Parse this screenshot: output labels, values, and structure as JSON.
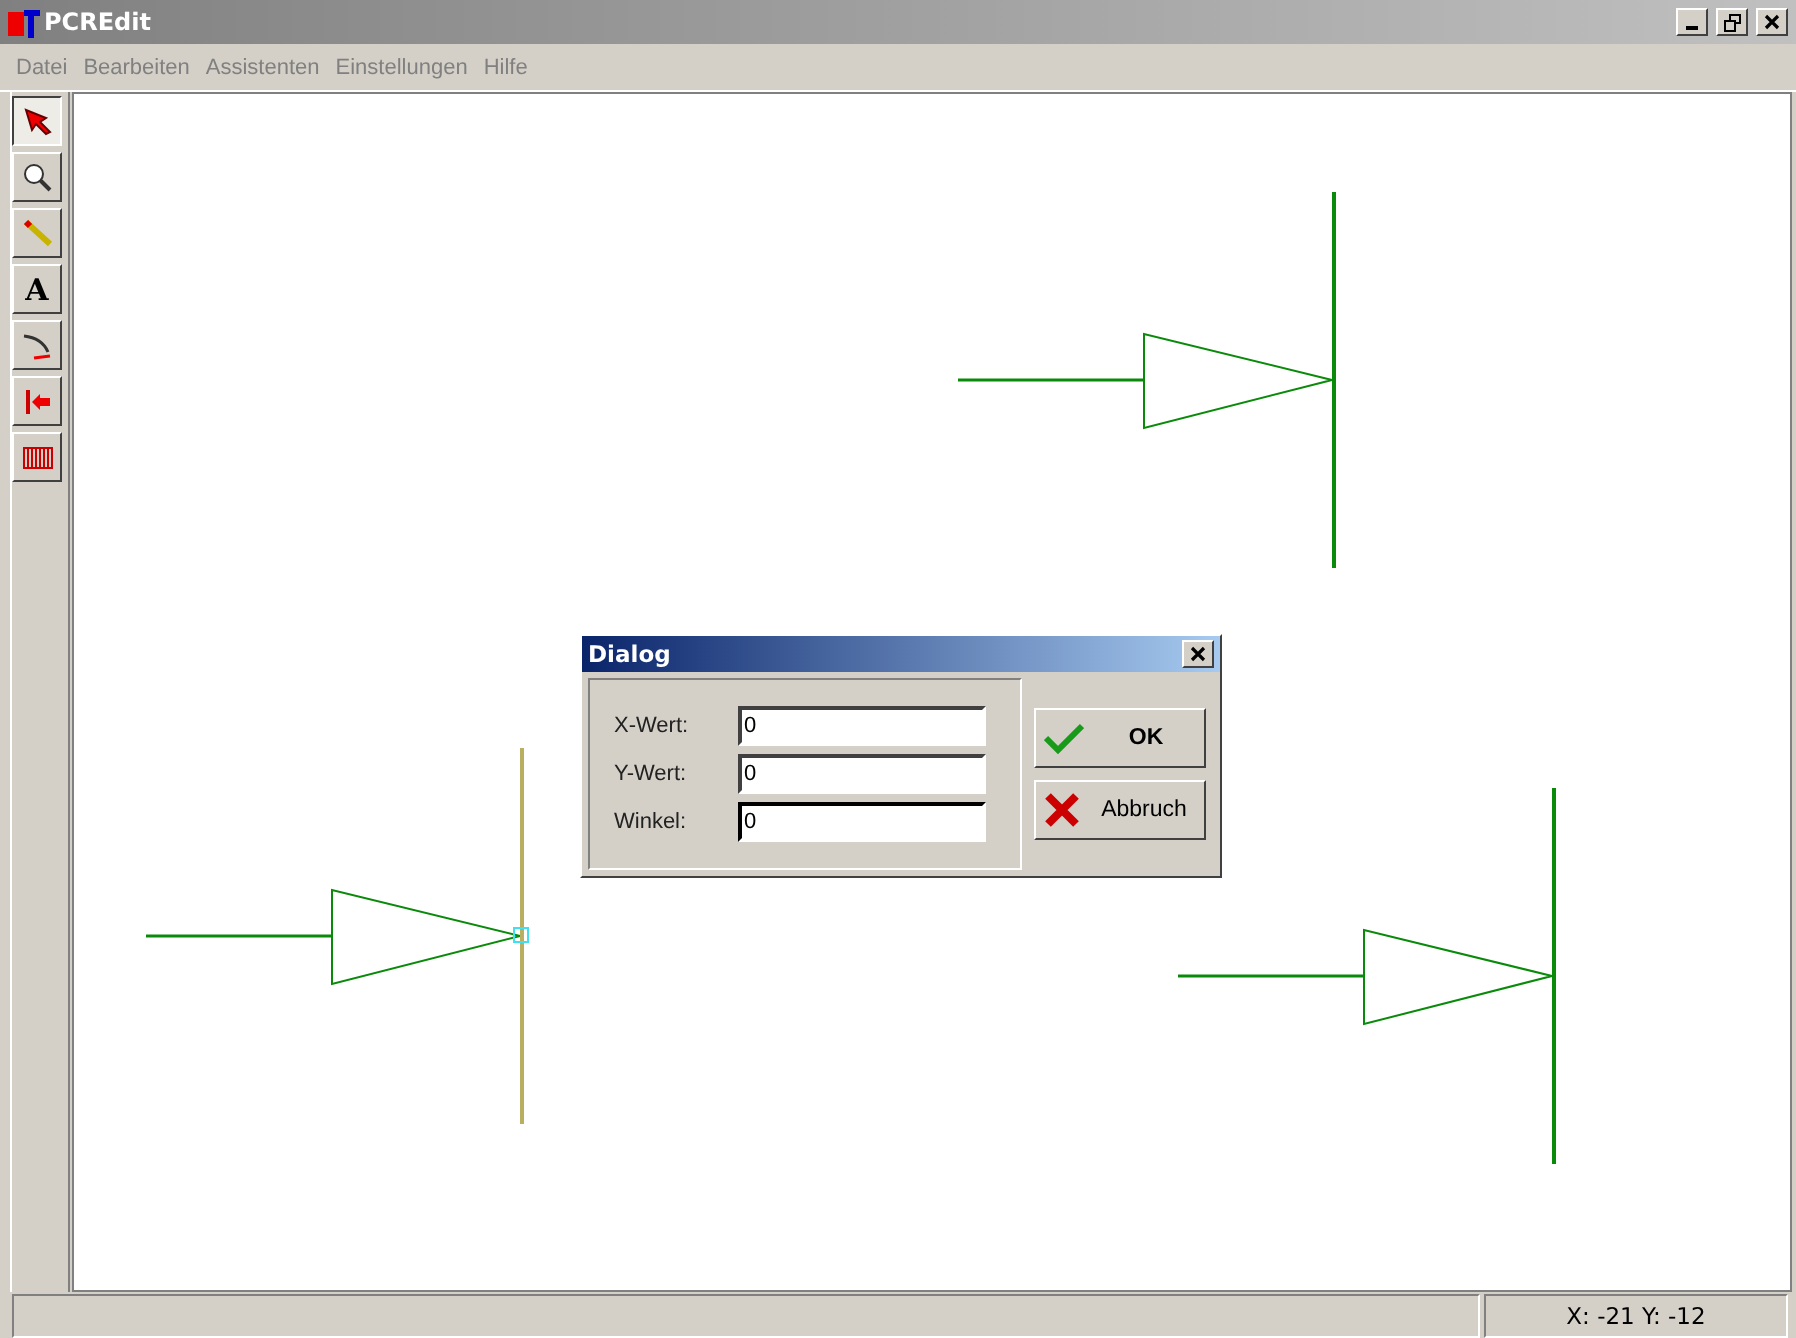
{
  "window": {
    "title": "PCREdit"
  },
  "menu": [
    "Datei",
    "Bearbeiten",
    "Assistenten",
    "Einstellungen",
    "Hilfe"
  ],
  "tools": [
    {
      "kind": "pointer",
      "selected": true
    },
    {
      "kind": "zoom",
      "selected": false
    },
    {
      "kind": "pencil",
      "selected": false
    },
    {
      "kind": "text",
      "label": "A",
      "selected": false
    },
    {
      "kind": "curve",
      "selected": false
    },
    {
      "kind": "pin",
      "selected": false
    },
    {
      "kind": "grid",
      "selected": false
    }
  ],
  "symbols": [
    {
      "selected": false
    },
    {
      "selected": true
    },
    {
      "selected": false
    }
  ],
  "dialog": {
    "title": "Dialog",
    "fields": [
      {
        "label": "X-Wert:",
        "value": "0",
        "focused": false
      },
      {
        "label": "Y-Wert:",
        "value": "0",
        "focused": false
      },
      {
        "label": "Winkel:",
        "value": "0",
        "focused": true
      }
    ],
    "buttons": [
      {
        "kind": "ok",
        "label": "OK"
      },
      {
        "kind": "cancel",
        "label": "Abbruch"
      }
    ]
  },
  "status_bar": {
    "coords": "X: -21 Y: -12"
  }
}
